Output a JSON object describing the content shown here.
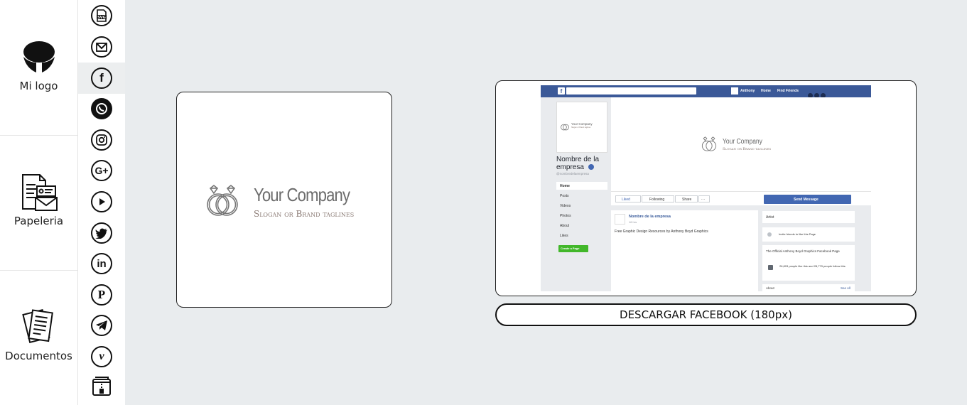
{
  "nav": {
    "items": [
      {
        "label": "Mi logo",
        "icon": "brand-logo-icon"
      },
      {
        "label": "Papeleria",
        "icon": "stationery-icon"
      },
      {
        "label": "Documentos",
        "icon": "documents-icon"
      }
    ]
  },
  "strip": {
    "icons": [
      "svg-file-icon",
      "gmail-icon",
      "facebook-icon",
      "whatsapp-icon",
      "instagram-icon",
      "google-plus-icon",
      "youtube-play-icon",
      "twitter-icon",
      "linkedin-icon",
      "pinterest-icon",
      "telegram-icon",
      "vimeo-icon",
      "zip-archive-icon"
    ],
    "active": "facebook-icon"
  },
  "logo": {
    "company": "Your Company",
    "slogan": "Slogan or Brand taglines"
  },
  "facebook_preview": {
    "topbar": {
      "user": "Anthony",
      "home": "Home",
      "find_friends": "Find Friends"
    },
    "page_name": "Nombre de la empresa",
    "handle": "@nombredelaempresa",
    "menu": [
      "Home",
      "Posts",
      "Videos",
      "Photos",
      "About",
      "Likes"
    ],
    "create_page": "Create a Page",
    "actions": {
      "liked": "Liked",
      "following": "Following",
      "share": "Share",
      "more": "···"
    },
    "send_message": "Send Message",
    "post": {
      "author": "Nombre de la empresa",
      "time": "16 hrs",
      "text": "Free Graphic Design Resources by Anthony Boyd Graphics"
    },
    "right": {
      "artist": "Artist",
      "invite": "Invite friends to like this Page",
      "official": "The Official Anthony Boyd Graphics Facebook Page",
      "likes": "26,803 people like this and 28,779 people follow this",
      "about": "About",
      "see_all": "See All"
    }
  },
  "download": {
    "label": "DESCARGAR FACEBOOK (180px)"
  },
  "colors": {
    "fb_blue": "#3b5998",
    "fb_button": "#4267b2",
    "create_green": "#42b72a"
  }
}
